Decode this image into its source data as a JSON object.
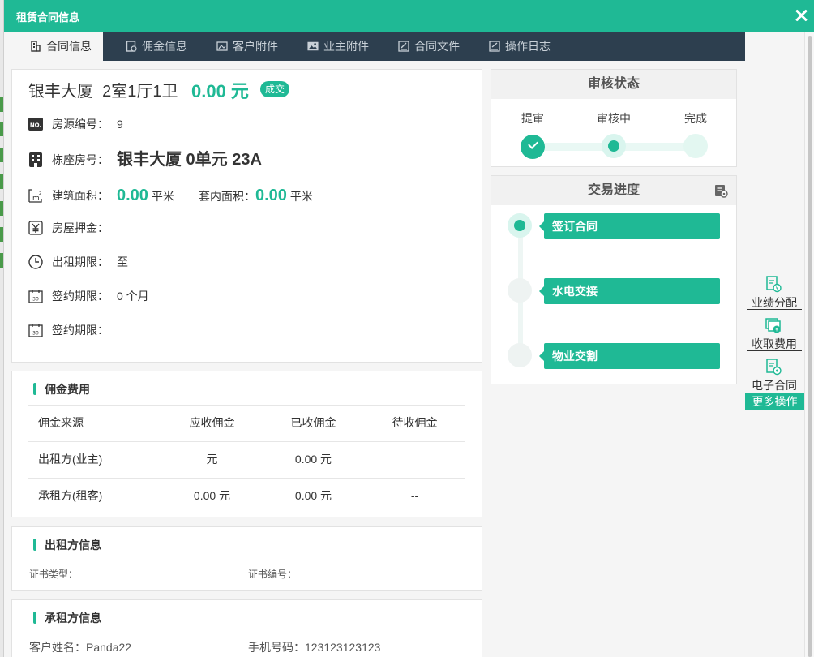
{
  "modal": {
    "title": "租赁合同信息"
  },
  "tabs": [
    {
      "label": "合同信息",
      "icon": "building-icon",
      "active": true
    },
    {
      "label": "佣金信息",
      "icon": "commission-icon"
    },
    {
      "label": "客户附件",
      "icon": "image-attach-icon"
    },
    {
      "label": "业主附件",
      "icon": "picture-icon"
    },
    {
      "label": "合同文件",
      "icon": "edit-doc-icon"
    },
    {
      "label": "操作日志",
      "icon": "log-icon"
    }
  ],
  "house": {
    "name": "银丰大厦",
    "layout": "2室1厅1卫",
    "price": "0.00 元",
    "badge": "成交",
    "fields": {
      "source_no": {
        "label": "房源编号：",
        "value": "9"
      },
      "building": {
        "label": "栋座房号：",
        "value": "银丰大厦 0单元 23A"
      },
      "area": {
        "label": "建筑面积：",
        "value": "0.00",
        "unit": "平米",
        "inner_label": "套内面积：",
        "inner_value": "0.00",
        "inner_unit": "平米"
      },
      "deposit": {
        "label": "房屋押金：",
        "value": ""
      },
      "rent_period": {
        "label": "出租期限：",
        "value": "至"
      },
      "sign_period": {
        "label": "签约期限：",
        "value": "0 个月"
      },
      "sign_period2": {
        "label": "签约期限：",
        "value": ""
      }
    }
  },
  "commission": {
    "title": "佣金费用",
    "headers": [
      "佣金来源",
      "应收佣金",
      "已收佣金",
      "待收佣金"
    ],
    "rows": [
      [
        "出租方(业主)",
        "元",
        "0.00 元",
        ""
      ],
      [
        "承租方(租客)",
        "0.00 元",
        "0.00 元",
        "--"
      ]
    ]
  },
  "landlord": {
    "title": "出租方信息",
    "cert_type_label": "证书类型：",
    "cert_no_label": "证书编号："
  },
  "tenant": {
    "title": "承租方信息",
    "name_label": "客户姓名：",
    "name": "Panda22",
    "phone_label": "手机号码：",
    "phone": "123123123123"
  },
  "review": {
    "title": "审核状态",
    "steps": [
      "提审",
      "审核中",
      "完成"
    ]
  },
  "progress": {
    "title": "交易进度",
    "steps": [
      "签订合同",
      "水电交接",
      "物业交割"
    ]
  },
  "side_actions": [
    {
      "label": "业绩分配",
      "icon": "performance-doc-icon"
    },
    {
      "label": "收取费用",
      "icon": "fee-collect-icon"
    },
    {
      "label": "电子合同",
      "icon": "e-contract-icon"
    }
  ],
  "more_label": "更多操作",
  "colors": {
    "accent": "#1fb995",
    "tab_bar": "#2d3f4f"
  }
}
